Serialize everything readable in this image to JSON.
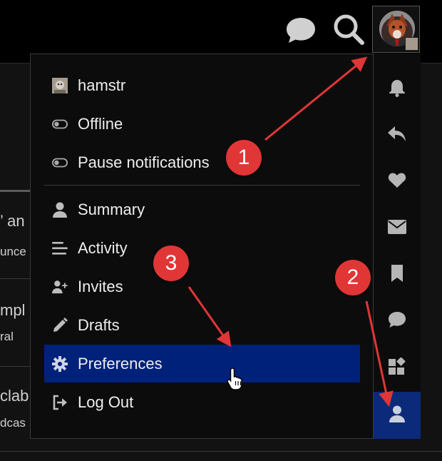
{
  "background": {
    "rows": [
      {
        "title_fragment": "’ an",
        "sub_fragment": "unce"
      },
      {
        "title_fragment": "mpl",
        "sub_fragment": "ral"
      },
      {
        "title_fragment": "clab",
        "sub_fragment": "dcas"
      }
    ]
  },
  "header": {
    "chat_icon": "chat-bubble-icon",
    "search_icon": "search-icon",
    "avatar": "user-avatar"
  },
  "user_menu": {
    "username": "hamstr",
    "status_items": [
      {
        "label": "Offline",
        "icon": "toggle-off-icon"
      },
      {
        "label": "Pause notifications",
        "icon": "toggle-off-icon"
      }
    ],
    "items": [
      {
        "label": "Summary",
        "icon": "user-icon"
      },
      {
        "label": "Activity",
        "icon": "stream-icon"
      },
      {
        "label": "Invites",
        "icon": "user-plus-icon"
      },
      {
        "label": "Drafts",
        "icon": "pencil-icon"
      },
      {
        "label": "Preferences",
        "icon": "gear-icon",
        "active": true
      },
      {
        "label": "Log Out",
        "icon": "sign-out-icon"
      }
    ]
  },
  "tabs": [
    {
      "name": "notifications",
      "icon": "bell-icon"
    },
    {
      "name": "replies",
      "icon": "reply-icon"
    },
    {
      "name": "likes",
      "icon": "heart-icon"
    },
    {
      "name": "messages",
      "icon": "envelope-icon"
    },
    {
      "name": "bookmarks",
      "icon": "bookmark-icon"
    },
    {
      "name": "chat",
      "icon": "comment-icon"
    },
    {
      "name": "other",
      "icon": "widgets-icon"
    },
    {
      "name": "profile",
      "icon": "user-icon",
      "active": true
    }
  ],
  "callouts": [
    "1",
    "2",
    "3"
  ],
  "colors": {
    "accent_active": "#00217a",
    "callout_red": "#e03636",
    "background": "#111111"
  }
}
